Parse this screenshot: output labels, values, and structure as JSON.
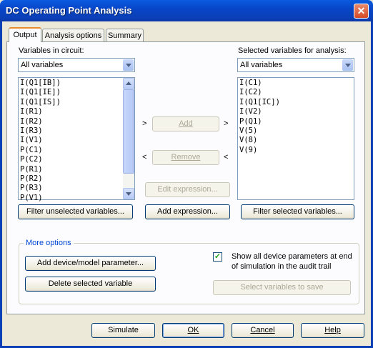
{
  "window": {
    "title": "DC Operating Point Analysis"
  },
  "tabs": [
    {
      "label": "Output"
    },
    {
      "label": "Analysis options"
    },
    {
      "label": "Summary"
    }
  ],
  "left": {
    "label": "Variables in circuit:",
    "filter_value": "All variables",
    "items": [
      "I(Q1[IB])",
      "I(Q1[IE])",
      "I(Q1[IS])",
      "I(R1)",
      "I(R2)",
      "I(R3)",
      "I(V1)",
      "P(C1)",
      "P(C2)",
      "P(R1)",
      "P(R2)",
      "P(R3)",
      "P(V1)"
    ],
    "filter_button": "Filter unselected variables..."
  },
  "right": {
    "label": "Selected variables for analysis:",
    "filter_value": "All variables",
    "items": [
      "I(C1)",
      "I(C2)",
      "I(Q1[IC])",
      "I(V2)",
      "P(Q1)",
      "V(5)",
      "V(8)",
      "V(9)"
    ],
    "filter_button": "Filter selected variables..."
  },
  "middle": {
    "add": "Add",
    "remove": "Remove",
    "edit_expression": "Edit expression...",
    "add_expression": "Add expression...",
    "arrow_right": ">",
    "arrow_left": "<"
  },
  "more_options": {
    "legend": "More options",
    "add_param": "Add device/model parameter...",
    "delete_var": "Delete selected variable",
    "show_params_line1": "Show all device parameters at end",
    "show_params_line2": "of simulation in the audit trail",
    "show_params_checked": true,
    "select_to_save": "Select variables to save"
  },
  "footer": {
    "simulate": "Simulate",
    "ok": "OK",
    "cancel": "Cancel",
    "help": "Help"
  }
}
